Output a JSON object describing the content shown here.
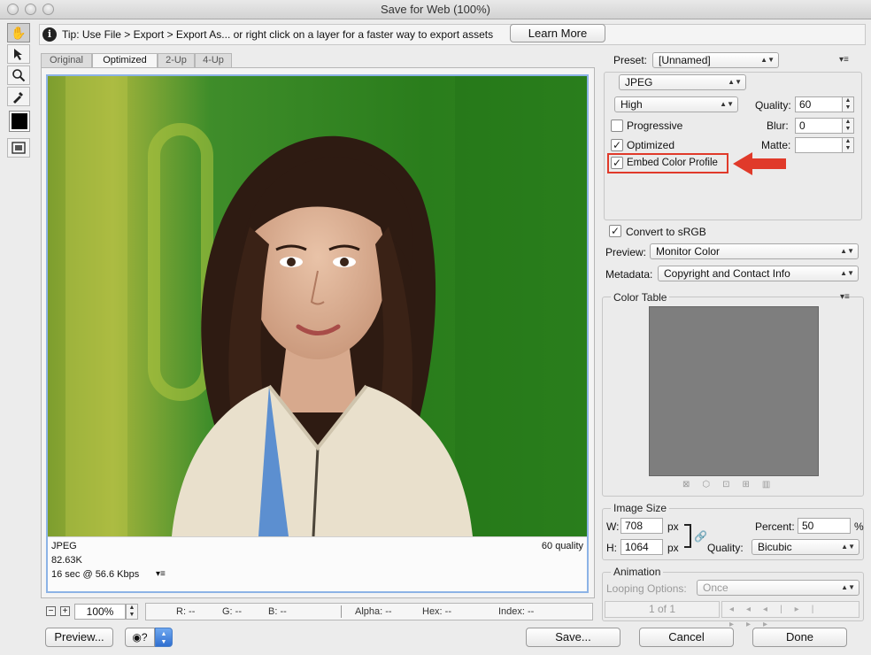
{
  "window": {
    "title": "Save for Web (100%)"
  },
  "tip": {
    "text": "Tip: Use File > Export > Export As...  or right click on a layer for a faster way to export assets",
    "learn_more": "Learn More"
  },
  "tabs": [
    "Original",
    "Optimized",
    "2-Up",
    "4-Up"
  ],
  "image_info": {
    "format": "JPEG",
    "size": "82.63K",
    "download": "16 sec @ 56.6 Kbps",
    "quality": "60 quality"
  },
  "zoom": "100%",
  "status": {
    "r": "R: --",
    "g": "G: --",
    "b": "B: --",
    "alpha": "Alpha: --",
    "hex": "Hex: --",
    "index": "Index: --"
  },
  "buttons": {
    "preview": "Preview...",
    "save": "Save...",
    "cancel": "Cancel",
    "done": "Done"
  },
  "settings": {
    "preset_label": "Preset:",
    "preset_value": "[Unnamed]",
    "format": "JPEG",
    "compression": "High",
    "quality_label": "Quality:",
    "quality_value": "60",
    "blur_label": "Blur:",
    "blur_value": "0",
    "matte_label": "Matte:",
    "progressive": "Progressive",
    "optimized": "Optimized",
    "embed_profile": "Embed Color Profile",
    "convert_srgb": "Convert to sRGB",
    "preview_label": "Preview:",
    "preview_value": "Monitor Color",
    "metadata_label": "Metadata:",
    "metadata_value": "Copyright and Contact Info"
  },
  "color_table": {
    "title": "Color Table"
  },
  "image_size": {
    "title": "Image Size",
    "w_label": "W:",
    "w_value": "708",
    "h_label": "H:",
    "h_value": "1064",
    "unit": "px",
    "percent_label": "Percent:",
    "percent_value": "50",
    "percent_unit": "%",
    "quality_label": "Quality:",
    "quality_value": "Bicubic"
  },
  "animation": {
    "title": "Animation",
    "looping_label": "Looping Options:",
    "looping_value": "Once",
    "frame_counter": "1 of 1"
  },
  "colors": {
    "accent_highlight": "#e03a2a",
    "canvas_frame": "#8cb3e6",
    "photo_background": "#2f8a1f"
  }
}
